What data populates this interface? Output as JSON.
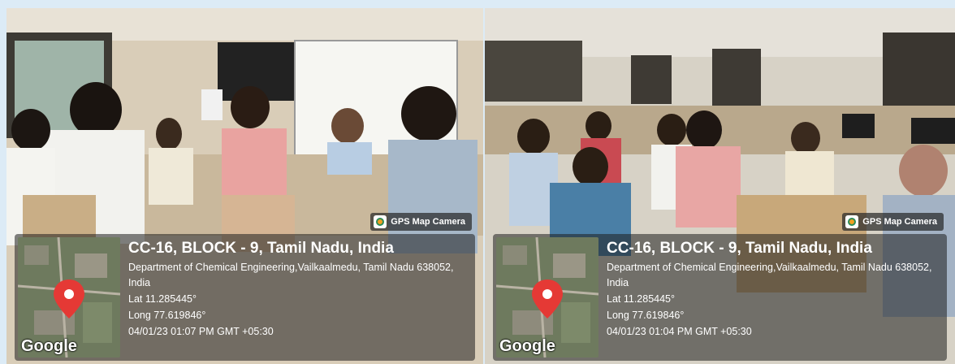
{
  "photos": [
    {
      "badge": "GPS Map Camera",
      "title": "CC-16, BLOCK - 9, Tamil Nadu, India",
      "address": "Department of Chemical Engineering,Vailkaalmedu, Tamil Nadu 638052, India",
      "lat": "Lat 11.285445°",
      "long": "Long 77.619846°",
      "timestamp": "04/01/23 01:07 PM GMT +05:30",
      "map_brand": "Google"
    },
    {
      "badge": "GPS Map Camera",
      "title": "CC-16, BLOCK - 9, Tamil Nadu, India",
      "address": "Department of Chemical Engineering,Vailkaalmedu, Tamil Nadu 638052, India",
      "lat": "Lat 11.285445°",
      "long": "Long 77.619846°",
      "timestamp": "04/01/23 01:04 PM GMT +05:30",
      "map_brand": "Google"
    }
  ],
  "colors": {
    "badge_bg": "#282828",
    "pin": "#e53935",
    "page_bg": "#dcebf6"
  }
}
